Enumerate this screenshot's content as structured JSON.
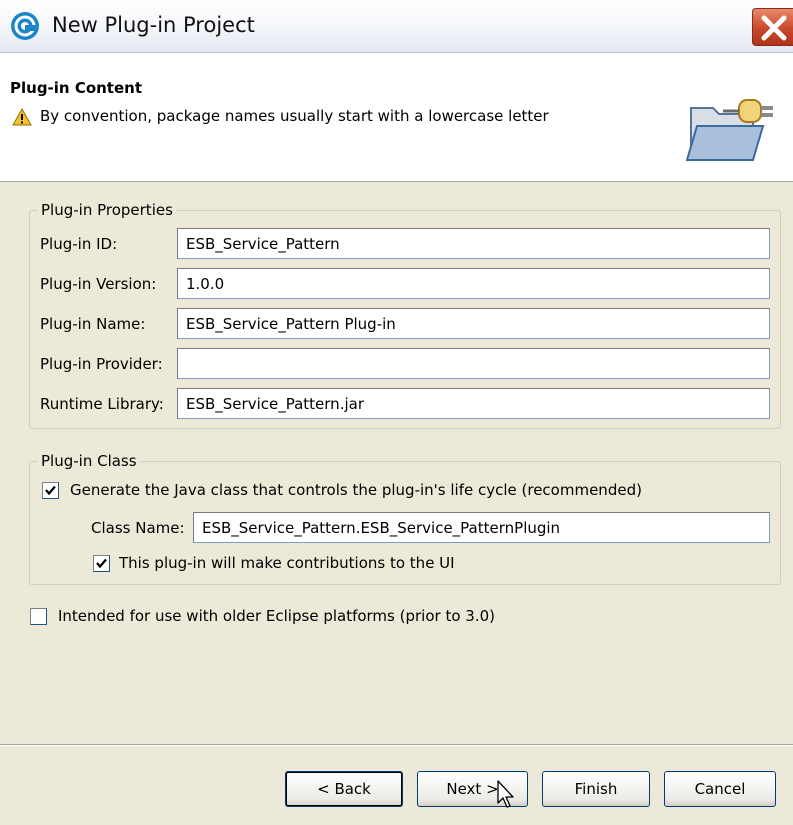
{
  "window": {
    "title": "New Plug-in Project"
  },
  "header": {
    "title": "Plug-in Content",
    "message": "By convention, package names usually start with a lowercase letter"
  },
  "properties": {
    "legend": "Plug-in Properties",
    "fields": [
      {
        "label": "Plug-in ID:",
        "value": "ESB_Service_Pattern"
      },
      {
        "label": "Plug-in Version:",
        "value": "1.0.0"
      },
      {
        "label": "Plug-in Name:",
        "value": "ESB_Service_Pattern Plug-in"
      },
      {
        "label": "Plug-in Provider:",
        "value": ""
      },
      {
        "label": "Runtime Library:",
        "value": "ESB_Service_Pattern.jar"
      }
    ]
  },
  "plugin_class": {
    "legend": "Plug-in Class",
    "generate_label": "Generate the Java class that controls the plug-in's life cycle (recommended)",
    "generate_checked": true,
    "class_name_label": "Class Name:",
    "class_name_value": "ESB_Service_Pattern.ESB_Service_PatternPlugin",
    "ui_label": "This plug-in will make contributions to the UI",
    "ui_checked": true
  },
  "legacy": {
    "label": "Intended for use with older Eclipse platforms (prior to 3.0)",
    "checked": false
  },
  "buttons": {
    "back": "< Back",
    "next": "Next >",
    "finish": "Finish",
    "cancel": "Cancel"
  },
  "icons": [
    "app-icon",
    "close-icon",
    "warning-icon",
    "wizard-folder-plugin-icon",
    "checkmark-icon",
    "mouse-pointer-icon"
  ]
}
